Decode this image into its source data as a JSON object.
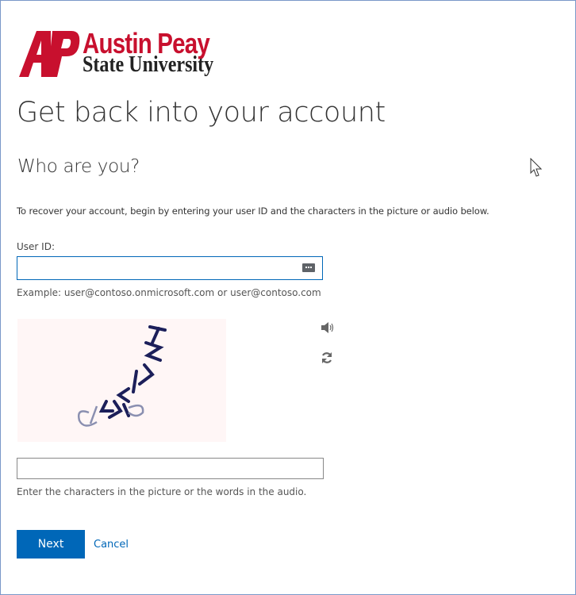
{
  "logo": {
    "line1": "Austin Peay",
    "line2": "State University",
    "brand_color": "#c8102e"
  },
  "page": {
    "title": "Get back into your account",
    "subtitle": "Who are you?",
    "instructions": "To recover your account, begin by entering your user ID and the characters in the picture or audio below."
  },
  "user_id": {
    "label": "User ID:",
    "value": "",
    "example": "Example: user@contoso.onmicrosoft.com or user@contoso.com",
    "icon": "password-manager-icon"
  },
  "captcha": {
    "image_icon": "captcha-image",
    "audio_icon": "speaker-icon",
    "refresh_icon": "refresh-icon",
    "value": "",
    "help": "Enter the characters in the picture or the words in the audio."
  },
  "actions": {
    "next_label": "Next",
    "cancel_label": "Cancel",
    "accent_color": "#0067b8"
  }
}
